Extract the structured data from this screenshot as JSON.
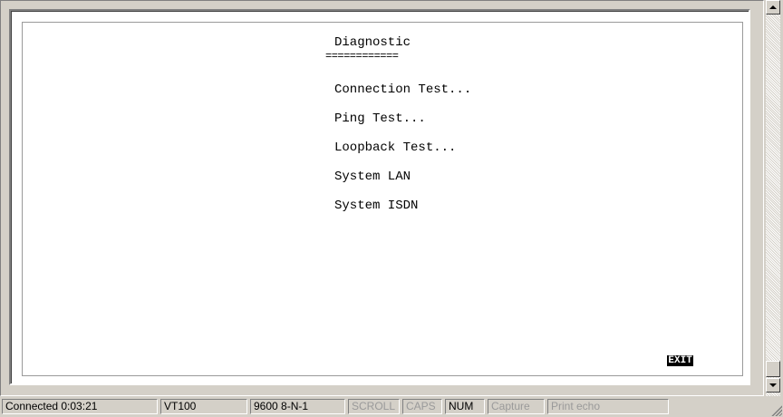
{
  "terminal": {
    "heading": "Diagnostic",
    "underline": "============",
    "menu_items": [
      "Connection Test...",
      "Ping Test...",
      "Loopback Test...",
      "System LAN",
      "System ISDN"
    ],
    "exit_label": "EXIT"
  },
  "statusbar": {
    "connection": "Connected 0:03:21",
    "emulation": "VT100",
    "port_settings": "9600 8-N-1",
    "scroll": "SCROLL",
    "caps": "CAPS",
    "num": "NUM",
    "capture": "Capture",
    "print_echo": "Print echo"
  },
  "icons": {
    "scroll_up": "up-arrow-icon",
    "scroll_down": "down-arrow-icon",
    "resize_grip": "resize-grip-icon"
  },
  "colors": {
    "window_bg": "#d4d0c8",
    "terminal_bg": "#ffffff",
    "highlight_bg": "#000000",
    "highlight_fg": "#ffffff",
    "disabled_text": "#9a9a9a"
  }
}
